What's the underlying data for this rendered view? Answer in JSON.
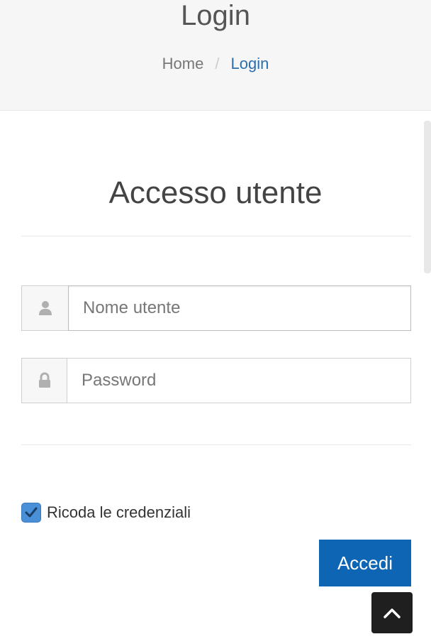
{
  "header": {
    "title": "Login",
    "breadcrumb": {
      "home": "Home",
      "separator": "/",
      "current": "Login"
    }
  },
  "main": {
    "section_title": "Accesso utente",
    "username": {
      "placeholder": "Nome utente",
      "value": "",
      "icon": "user-icon"
    },
    "password": {
      "placeholder": "Password",
      "value": "",
      "icon": "lock-icon"
    },
    "remember": {
      "label": "Ricoda le credenziali",
      "checked": true
    },
    "submit_label": "Accedi"
  },
  "colors": {
    "accent": "#0e65b4",
    "link": "#2a6fb0",
    "checkbox": "#4a90d9",
    "back_to_top": "#1f1f1f"
  },
  "back_to_top": {
    "icon": "chevron-up-icon"
  }
}
